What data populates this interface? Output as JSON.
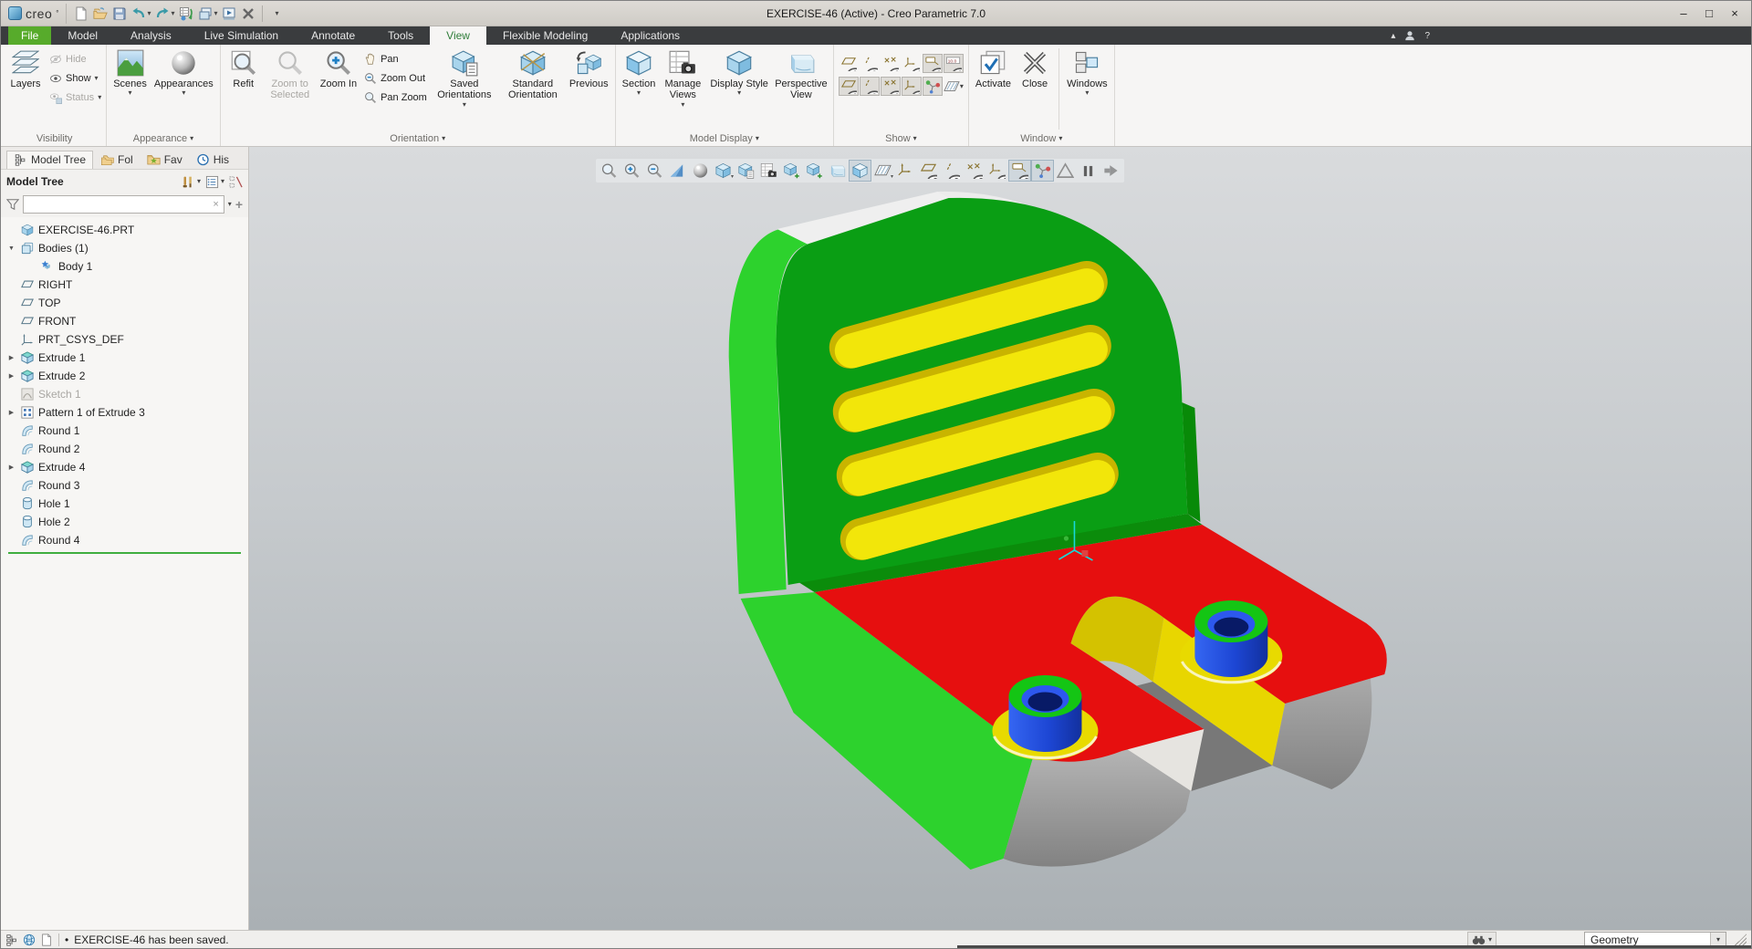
{
  "window": {
    "title": "EXERCISE-46 (Active) - Creo Parametric 7.0",
    "controls": {
      "minimize": "–",
      "maximize": "□",
      "close": "×"
    }
  },
  "logo": {
    "text": "creo",
    "mark": "°"
  },
  "glyphs": {
    "dropdown": "▾",
    "expand_down": "▼",
    "expand_right": "▶",
    "bullet": "•",
    "clear": "×",
    "add": "+",
    "help": "?",
    "collapse_ribbon": "▴"
  },
  "tabs": {
    "items": [
      "File",
      "Model",
      "Analysis",
      "Live Simulation",
      "Annotate",
      "Tools",
      "View",
      "Flexible Modeling",
      "Applications"
    ],
    "active": "View"
  },
  "ribbon": {
    "visibility": {
      "label": "Visibility",
      "layers": "Layers",
      "hide": "Hide",
      "show": "Show",
      "status": "Status"
    },
    "appearance": {
      "label": "Appearance",
      "scenes": "Scenes",
      "appearances": "Appearances"
    },
    "orientation": {
      "label": "Orientation",
      "refit": "Refit",
      "zoom_to_selected": "Zoom to Selected",
      "zoom_in": "Zoom In",
      "pan": "Pan",
      "zoom_out": "Zoom Out",
      "pan_zoom": "Pan Zoom",
      "saved_orientations": "Saved Orientations",
      "standard_orientation": "Standard Orientation",
      "previous": "Previous"
    },
    "model_display": {
      "label": "Model Display",
      "section": "Section",
      "manage_views": "Manage Views",
      "display_style": "Display Style",
      "perspective_view": "Perspective View"
    },
    "show": {
      "label": "Show",
      "icons": [
        "plane-display",
        "axis-display",
        "point-display",
        "csys-display",
        "annotation-display",
        "dimension-display",
        "plane-tag-display",
        "axis-tag-display",
        "point-tag-display",
        "csys-tag-display",
        "spin-center-display",
        "section-datum-display"
      ]
    },
    "window_group": {
      "label": "Window",
      "activate": "Activate",
      "close": "Close",
      "windows": "Windows"
    }
  },
  "qat_icons": [
    "new",
    "open",
    "save",
    "undo",
    "redo",
    "regenerate",
    "windows-stack",
    "model-player",
    "close-window",
    "customize"
  ],
  "model_tree": {
    "panel_tabs": [
      "Model Tree",
      "Fol",
      "Fav",
      "His"
    ],
    "title": "Model Tree",
    "search_value": "",
    "items": [
      {
        "label": "EXERCISE-46.PRT",
        "icon": "part"
      },
      {
        "label": "Bodies (1)",
        "icon": "bodies",
        "expander": "expanded"
      },
      {
        "label": "Body 1",
        "icon": "body"
      },
      {
        "label": "RIGHT",
        "icon": "datum-plane"
      },
      {
        "label": "TOP",
        "icon": "datum-plane"
      },
      {
        "label": "FRONT",
        "icon": "datum-plane"
      },
      {
        "label": "PRT_CSYS_DEF",
        "icon": "csys"
      },
      {
        "label": "Extrude 1",
        "icon": "extrude",
        "expander": "collapsed"
      },
      {
        "label": "Extrude 2",
        "icon": "extrude",
        "expander": "collapsed"
      },
      {
        "label": "Sketch 1",
        "icon": "sketch",
        "disabled": true
      },
      {
        "label": "Pattern 1 of Extrude 3",
        "icon": "pattern",
        "expander": "collapsed"
      },
      {
        "label": "Round 1",
        "icon": "round"
      },
      {
        "label": "Round 2",
        "icon": "round"
      },
      {
        "label": "Extrude 4",
        "icon": "extrude",
        "expander": "collapsed"
      },
      {
        "label": "Round 3",
        "icon": "round"
      },
      {
        "label": "Hole 1",
        "icon": "hole"
      },
      {
        "label": "Hole 2",
        "icon": "hole"
      },
      {
        "label": "Round 4",
        "icon": "round"
      }
    ]
  },
  "graphics_toolbar": {
    "icons": [
      "refit",
      "zoom-in",
      "zoom-out",
      "repaint",
      "shading-quality",
      "display-style",
      "saved-orientations",
      "manage-views",
      "view-normal",
      "named-view",
      "perspective",
      "section",
      "datum-display-filters",
      "annotation-filters",
      "plane-display",
      "axis-display",
      "point-display",
      "csys-display",
      "annotation-display",
      "spin-center",
      "geometry-check",
      "pause",
      "exit-toolbar"
    ]
  },
  "statusbar": {
    "message": "EXERCISE-46 has been saved.",
    "filter_value": "Geometry"
  },
  "part_colors": {
    "green_bright": "#2dd22d",
    "green_face": "#0a9e14",
    "green_fold": "#0b8c0b",
    "red": "#e60f0f",
    "yellow": "#f2e60a",
    "yellow_dark": "#c9b400",
    "blue": "#2050e8",
    "blue_dark": "#081a66",
    "gray": "#a8a8a8",
    "white": "#efefef"
  }
}
